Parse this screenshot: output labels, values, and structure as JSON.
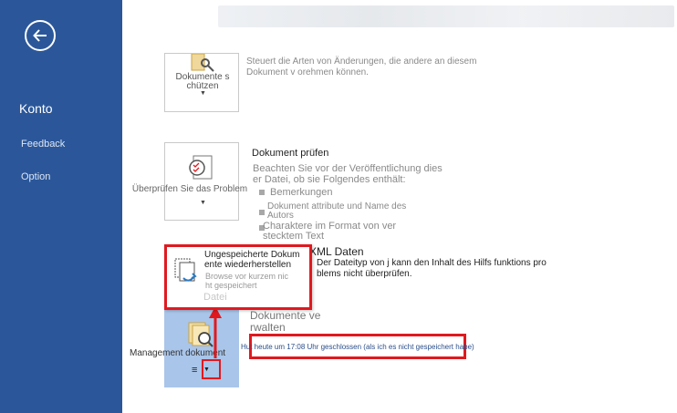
{
  "sidebar": {
    "back_label": "Zurück",
    "items": [
      {
        "label": "Konto"
      },
      {
        "label": "Feedback"
      },
      {
        "label": "Option"
      }
    ]
  },
  "protect": {
    "tile_line1": "Dokumente s",
    "tile_line2": "chützen",
    "description": "Steuert die Arten von Änderungen, die andere an diesem Dokument v orehmen können."
  },
  "inspect": {
    "tile_label": "Überprüfen Sie das Problem",
    "title": "Dokument prüfen",
    "intro": "Beachten Sie vor der Veröffentlichung dies er Datei, ob sie Folgendes enthält:",
    "bullets": [
      "Bemerkungen",
      "Dokument attribute und Name des Autors",
      "Charaktere im Format von ver stecktem Text"
    ]
  },
  "xml": {
    "title": "XML Daten",
    "description": "Der Dateityp von j kann den Inhalt des Hilfs funktions pro blems nicht überprüfen."
  },
  "popup": {
    "title_line1": "Ungespeicherte Dokum",
    "title_line2": "ente wiederherstellen",
    "desc_line1": "Browse vor kurzem nic",
    "desc_line2": "ht gespeichert",
    "faded_label": "Datei"
  },
  "manage": {
    "tile_label": "Management dokument",
    "title_line1": "Dokumente ve",
    "title_line2": "rwalten",
    "note": "Hut heute um 17:08 Uhr geschlossen (als ich es nicht gespeichert habe)"
  },
  "colors": {
    "sidebar": "#2b579a",
    "annotation_red": "#e0191f",
    "selected_tile": "#a9c5e9"
  }
}
